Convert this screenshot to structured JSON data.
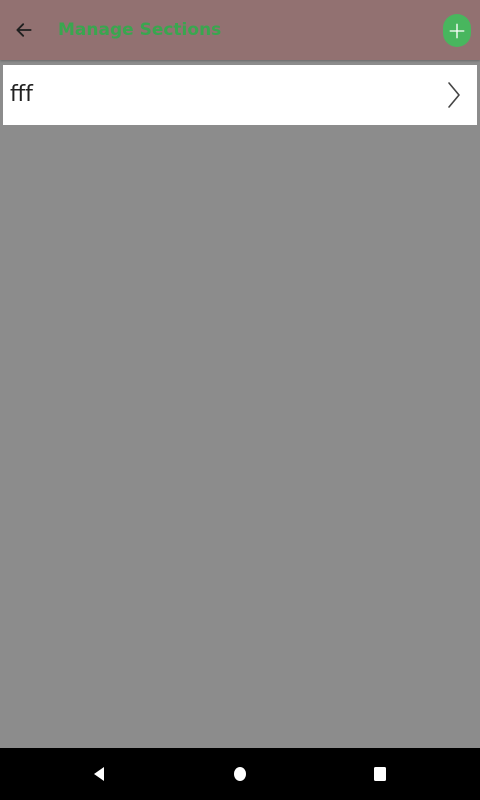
{
  "app_bar": {
    "title": "Manage Sections",
    "back_icon": "arrow-left-icon",
    "add_icon": "plus-icon",
    "background_color": "#927171",
    "title_color": "#39a64f",
    "add_button_color": "#48b65e"
  },
  "list": {
    "items": [
      {
        "label": "fff",
        "trailing_icon": "chevron-right-icon"
      }
    ]
  },
  "nav_bar": {
    "back_icon": "nav-back-icon",
    "home_icon": "nav-home-icon",
    "recents_icon": "nav-recents-icon"
  },
  "colors": {
    "page_background": "#8c8c8c",
    "list_item_background": "#ffffff",
    "nav_bar_background": "#000000"
  }
}
